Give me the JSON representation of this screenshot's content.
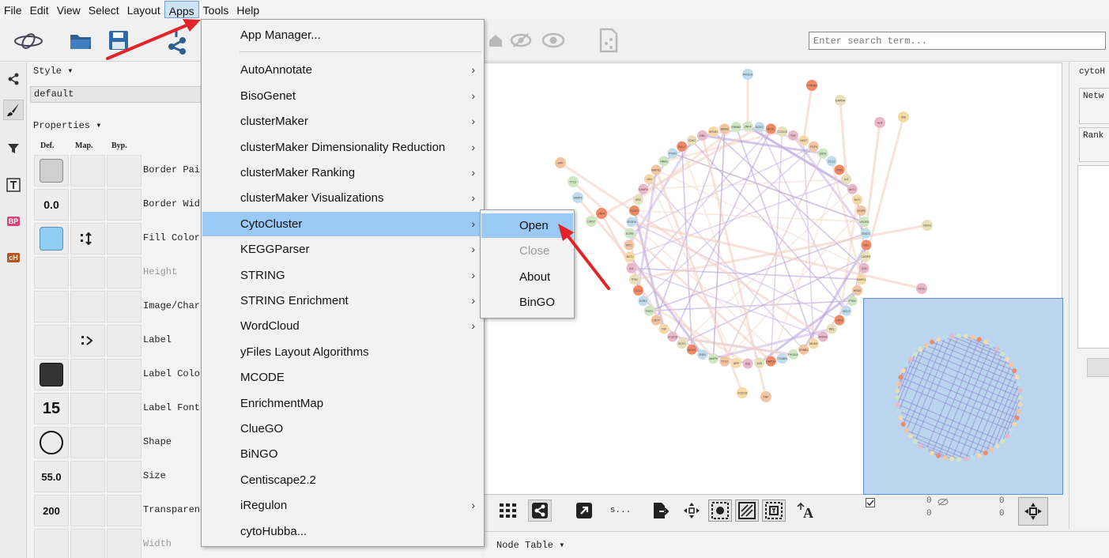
{
  "menubar": {
    "items": [
      "File",
      "Edit",
      "View",
      "Select",
      "Layout",
      "Apps",
      "Tools",
      "Help"
    ]
  },
  "search": {
    "placeholder": "Enter search term..."
  },
  "style_panel": {
    "style_label": "Style ▾",
    "style_selected": "default",
    "properties_label": "Properties ▾",
    "columns": {
      "def": "Def.",
      "map": "Map.",
      "byp": "Byp."
    },
    "rows": [
      {
        "label": "Border Paint",
        "value": ""
      },
      {
        "label": "Border Width",
        "value": "0.0"
      },
      {
        "label": "Fill Color",
        "value": ""
      },
      {
        "label": "Height",
        "value": ""
      },
      {
        "label": "Image/Chart",
        "value": ""
      },
      {
        "label": "Label",
        "value": ""
      },
      {
        "label": "Label Color",
        "value": ""
      },
      {
        "label": "Label Font",
        "value": "15"
      },
      {
        "label": "Shape",
        "value": ""
      },
      {
        "label": "Size",
        "value": "55.0"
      },
      {
        "label": "Transparency",
        "value": "200"
      },
      {
        "label": "Width",
        "value": ""
      }
    ]
  },
  "left_strip": {
    "badges": [
      "BP",
      "cH"
    ]
  },
  "apps_menu": {
    "items": [
      {
        "label": "App Manager...",
        "submenu": false
      },
      {
        "label": "AutoAnnotate",
        "submenu": true
      },
      {
        "label": "BisoGenet",
        "submenu": true
      },
      {
        "label": "clusterMaker",
        "submenu": true
      },
      {
        "label": "clusterMaker Dimensionality Reduction",
        "submenu": true
      },
      {
        "label": "clusterMaker Ranking",
        "submenu": true
      },
      {
        "label": "clusterMaker Visualizations",
        "submenu": true
      },
      {
        "label": "CytoCluster",
        "submenu": true
      },
      {
        "label": "KEGGParser",
        "submenu": true
      },
      {
        "label": "STRING",
        "submenu": true
      },
      {
        "label": "STRING Enrichment",
        "submenu": true
      },
      {
        "label": "WordCloud",
        "submenu": true
      },
      {
        "label": "yFiles Layout Algorithms",
        "submenu": false
      },
      {
        "label": "MCODE",
        "submenu": false
      },
      {
        "label": "EnrichmentMap",
        "submenu": false
      },
      {
        "label": "ClueGO",
        "submenu": false
      },
      {
        "label": "BiNGO",
        "submenu": false
      },
      {
        "label": "Centiscape2.2",
        "submenu": false
      },
      {
        "label": "iRegulon",
        "submenu": true
      },
      {
        "label": "cytoHubba...",
        "submenu": false
      }
    ],
    "highlighted": "CytoCluster",
    "arrow_glyph": "›"
  },
  "cytocluster_submenu": {
    "items": [
      {
        "label": "Open",
        "state": "highlight"
      },
      {
        "label": "Close",
        "state": "disabled"
      },
      {
        "label": "About",
        "state": "normal"
      },
      {
        "label": "BinGO",
        "state": "normal"
      }
    ]
  },
  "canvas_toolbar": {
    "s_label": "s...",
    "counter_a": "0",
    "counter_b": "0",
    "counter_c": "0",
    "counter_d": "0"
  },
  "node_table_label": "Node Table ▾",
  "right_panel": {
    "title": "cytoH",
    "netw": "Netw",
    "rank": "Rank"
  },
  "colors": {
    "menu_highlight": "#99c9f4",
    "annotation_arrow": "#e0242a",
    "fill_color_swatch": "#8fcdf5",
    "overview_bg": "#bcd5ee"
  },
  "network_labels": [
    "ZNF4",
    "NOX3",
    "NCS1",
    "CCDC8",
    "TNF",
    "LMO7",
    "FGF4",
    "ESR1",
    "CCL2",
    "TP53",
    "IL6",
    "AKT1",
    "MYC",
    "EGFR",
    "VEGFA",
    "STAT3",
    "SRC",
    "CASP3",
    "JUN",
    "MAPK1",
    "HRAS",
    "PTEN",
    "BCL2",
    "CDK2",
    "RB1",
    "NFKB1",
    "MDM2",
    "ERBB2",
    "PIK3CA",
    "CTNNB1",
    "GAPDH",
    "ALB",
    "INS",
    "APP",
    "TTC2",
    "MMP9"
  ]
}
